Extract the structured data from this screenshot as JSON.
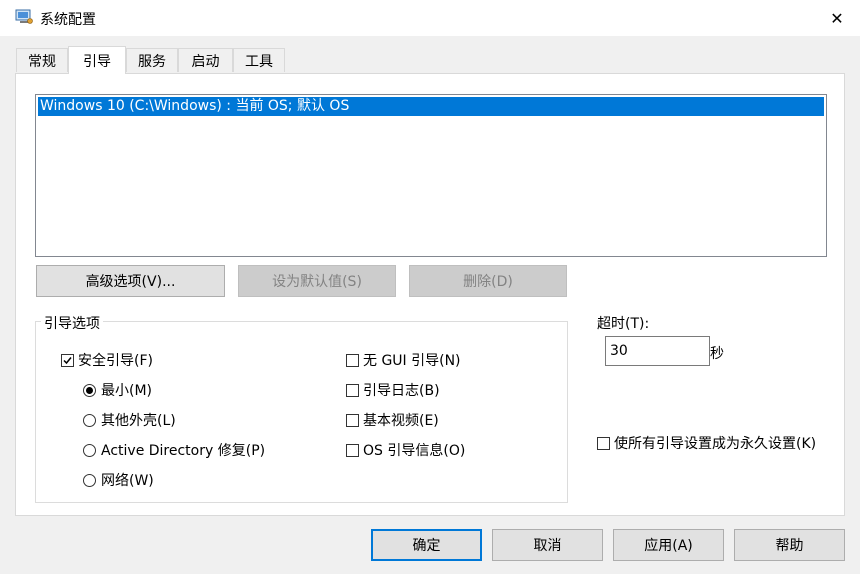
{
  "window": {
    "title": "系统配置",
    "close_glyph": "✕"
  },
  "tabs": [
    {
      "label": "常规",
      "active": false
    },
    {
      "label": "引导",
      "active": true
    },
    {
      "label": "服务",
      "active": false
    },
    {
      "label": "启动",
      "active": false
    },
    {
      "label": "工具",
      "active": false
    }
  ],
  "os_list": [
    {
      "label": "Windows 10 (C:\\Windows) : 当前 OS; 默认 OS",
      "selected": true
    }
  ],
  "list_buttons": {
    "advanced": "高级选项(V)...",
    "set_default": "设为默认值(S)",
    "delete": "删除(D)"
  },
  "boot_options": {
    "group_label": "引导选项",
    "safe_boot": {
      "label": "安全引导(F)",
      "checked": true
    },
    "radios": [
      {
        "label": "最小(M)",
        "checked": true
      },
      {
        "label": "其他外壳(L)",
        "checked": false
      },
      {
        "label": "Active Directory 修复(P)",
        "checked": false
      },
      {
        "label": "网络(W)",
        "checked": false
      }
    ],
    "checkboxes": [
      {
        "label": "无 GUI 引导(N)",
        "checked": false
      },
      {
        "label": "引导日志(B)",
        "checked": false
      },
      {
        "label": "基本视频(E)",
        "checked": false
      },
      {
        "label": "OS 引导信息(O)",
        "checked": false
      }
    ]
  },
  "timeout": {
    "label": "超时(T):",
    "value": "30",
    "unit": "秒"
  },
  "permanent": {
    "label": "使所有引导设置成为永久设置(K)",
    "checked": false
  },
  "footer": {
    "ok": "确定",
    "cancel": "取消",
    "apply": "应用(A)",
    "help": "帮助"
  },
  "colors": {
    "selection": "#0078d7",
    "default_button_border": "#0078d7"
  }
}
